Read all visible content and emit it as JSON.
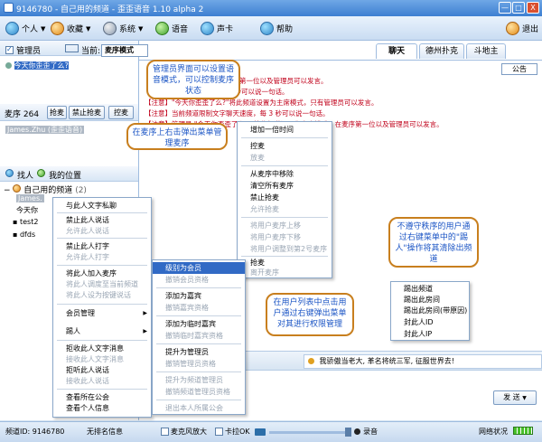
{
  "window": {
    "title": "9146780 - 自己用的频道 - 歪歪语音 1.10 alpha 2",
    "minimize": "—",
    "maximize": "□",
    "close": "X"
  },
  "toolbar": {
    "items": [
      {
        "label": "个人",
        "icon": "person-icon"
      },
      {
        "label": "收藏",
        "icon": "star-icon"
      },
      {
        "label": "系统",
        "icon": "gear-icon"
      },
      {
        "label": "语音",
        "icon": "phone-icon"
      },
      {
        "label": "声卡",
        "icon": "sound-icon"
      },
      {
        "label": "帮助",
        "icon": "help-icon"
      }
    ],
    "exit_label": "退出"
  },
  "left": {
    "admin_label": "管理员",
    "current_label": "当前:",
    "mode_select": "麦序模式",
    "announcement_row": "今天你歪歪了么?",
    "queue_label": "麦序 264",
    "queue_buttons": [
      "抢麦",
      "禁止抢麦",
      "控麦"
    ],
    "queue_user": "James.Zhu (歪歪语音)",
    "find_label": "找人",
    "my_location": "我的位置",
    "channel_name": "自己用的频道",
    "channel_count": "(2)",
    "users": [
      "James.",
      "今天你",
      "test2",
      "dfds"
    ]
  },
  "tabs": [
    "聊天",
    "德州扑克",
    "斗地主"
  ],
  "messages": [
    "【注意】当前频道已设置为麦序第一位以及管理员可以发言。",
    "【注意】文字发言速度，每 3 秒可以说一句话。",
    "【注意】\"今天你歪歪了么?\"将此频道设置为主席模式，只有管理员可以发言。",
    "【注意】当前频道限制文字聊天速度，每 3 秒可以说一句话。",
    "【注意】管理员 \"今天你歪歪了么?\" 将此频道设置为麦序模式，在麦序第一位以及管理员可以发言。"
  ],
  "notice_button": "公告",
  "queue_menu": {
    "items": [
      {
        "label": "增加一倍时间",
        "disabled": false
      },
      {
        "label": "控麦",
        "disabled": false
      },
      {
        "label": "放麦",
        "disabled": true
      },
      {
        "label": "从麦序中移除",
        "disabled": false
      },
      {
        "label": "清空所有麦序",
        "disabled": false
      },
      {
        "label": "禁止抢麦",
        "disabled": false
      },
      {
        "label": "允许抢麦",
        "disabled": true
      },
      {
        "label": "将用户麦序上移",
        "disabled": true
      },
      {
        "label": "将用户麦序下移",
        "disabled": true
      },
      {
        "label": "将用户调整到第2号麦序",
        "disabled": true
      },
      {
        "label": "抢麦",
        "disabled": false
      },
      {
        "label": "离开麦序",
        "disabled": true
      }
    ]
  },
  "user_menu": {
    "items": [
      {
        "label": "与此人文字私聊",
        "disabled": false
      },
      {
        "label": "禁止此人说话",
        "disabled": false
      },
      {
        "label": "允许此人说话",
        "disabled": true
      },
      {
        "label": "禁止此人打字",
        "disabled": false
      },
      {
        "label": "允许此人打字",
        "disabled": true
      },
      {
        "label": "将此人加入麦序",
        "disabled": false
      },
      {
        "label": "将此人调度至当前频道",
        "disabled": true
      },
      {
        "label": "将此人设为按键说话",
        "disabled": true
      },
      {
        "label": "会员管理",
        "disabled": false
      },
      {
        "label": "踢人",
        "disabled": false
      },
      {
        "label": "拒收此人文字消息",
        "disabled": false
      },
      {
        "label": "接收此人文字消息",
        "disabled": true
      },
      {
        "label": "拒听此人说话",
        "disabled": false
      },
      {
        "label": "接收此人说话",
        "disabled": true
      },
      {
        "label": "查看所在公会",
        "disabled": false
      },
      {
        "label": "查看个人信息",
        "disabled": false
      }
    ]
  },
  "member_submenu": {
    "items": [
      {
        "label": "级别为会员",
        "disabled": false
      },
      {
        "label": "撤销会员资格",
        "disabled": true
      },
      {
        "label": "添加为嘉宾",
        "disabled": false
      },
      {
        "label": "撤销嘉宾资格",
        "disabled": true
      },
      {
        "label": "添加为临时嘉宾",
        "disabled": false
      },
      {
        "label": "撤销临时嘉宾资格",
        "disabled": true
      },
      {
        "label": "提升为管理员",
        "disabled": false
      },
      {
        "label": "撤销管理员资格",
        "disabled": true
      },
      {
        "label": "提升为频道管理员",
        "disabled": true
      },
      {
        "label": "撤销频道管理员资格",
        "disabled": true
      },
      {
        "label": "退出本人所属公会",
        "disabled": true
      }
    ]
  },
  "kick_submenu": {
    "items": [
      "踢出频道",
      "踢出此房间",
      "踢出此房间(带原因)",
      "封此人ID",
      "封此人IP"
    ]
  },
  "callouts": {
    "admin": "管理员界面可以设置语音模式，可以控制麦序状态",
    "queue": "在麦序上右击弹出菜单管理麦序",
    "kick": "不遵守秩序的用户通过右键菜单中的\"踢人\"操作将其清除出频道",
    "userlist": "在用户列表中点击用户通过右键弹出菜单对其进行权限管理"
  },
  "input_text": "我骄傲当老大, 革名将统三军, 征服世界去!",
  "send_button": "发 送",
  "status": {
    "channel_id": "频道ID: 9146780",
    "no_title": "无排名信息",
    "mic_amp": "麦克风放大",
    "card_ok": "卡拉OK",
    "record": "录音",
    "net_status": "网络状况"
  }
}
